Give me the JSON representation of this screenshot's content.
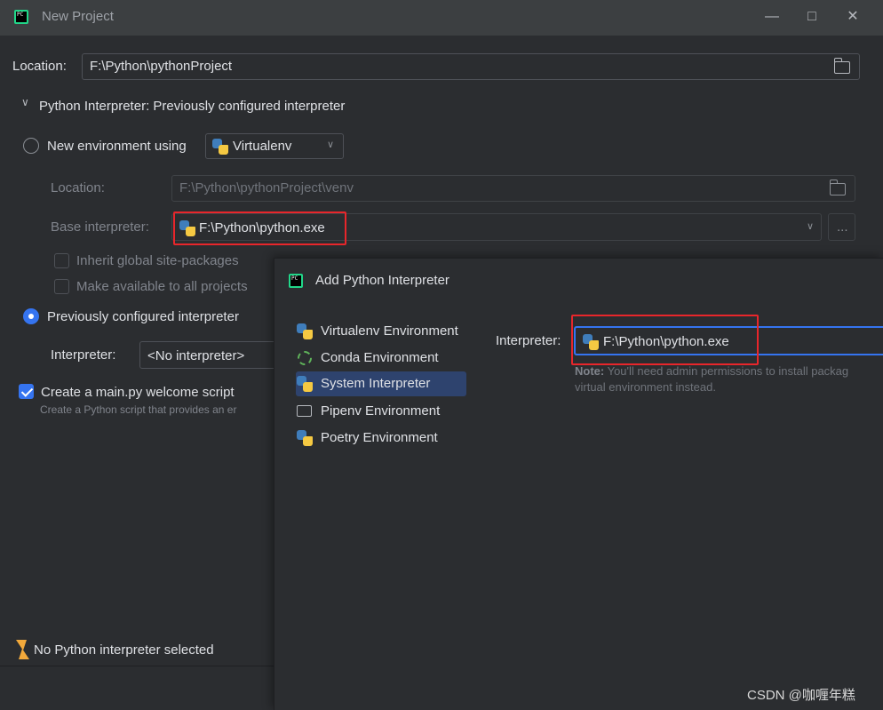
{
  "window": {
    "title": "New Project",
    "app_icon_text": "PC"
  },
  "main": {
    "location_label": "Location:",
    "location_value": "F:\\Python\\pythonProject",
    "interpreter_section_title": "Python Interpreter: Previously configured interpreter",
    "new_env_label": "New environment using",
    "new_env_tool": "Virtualenv",
    "env_location_label": "Location:",
    "env_location_value": "F:\\Python\\pythonProject\\venv",
    "base_interpreter_label": "Base interpreter:",
    "base_interpreter_value": "F:\\Python\\python.exe",
    "browse_label": "...",
    "inherit_label": "Inherit global site-packages",
    "make_available_label": "Make available to all projects",
    "prev_configured_label": "Previously configured interpreter",
    "interpreter_label": "Interpreter:",
    "interpreter_value": "<No interpreter>",
    "create_main_label": "Create a main.py welcome script",
    "create_main_hint": "Create a Python script that provides an er",
    "status_message": "No Python interpreter selected"
  },
  "dialog": {
    "title": "Add Python Interpreter",
    "items": [
      {
        "label": "Virtualenv Environment",
        "icon": "virtualenv-icon"
      },
      {
        "label": "Conda Environment",
        "icon": "conda-icon"
      },
      {
        "label": "System Interpreter",
        "icon": "python-icon"
      },
      {
        "label": "Pipenv Environment",
        "icon": "pipenv-icon"
      },
      {
        "label": "Poetry Environment",
        "icon": "poetry-icon"
      }
    ],
    "selected_index": 2,
    "interpreter_label": "Interpreter:",
    "interpreter_value": "F:\\Python\\python.exe",
    "note_bold": "Note:",
    "note_text": " You'll need admin permissions to install packag",
    "note_text2": "virtual environment instead."
  },
  "watermark": "CSDN @咖喱年糕",
  "colors": {
    "accent": "#3574f0",
    "highlight_box": "#e8262b",
    "selection": "#2e436e"
  }
}
